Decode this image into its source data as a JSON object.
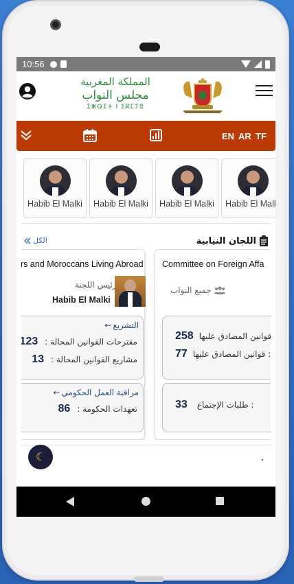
{
  "status_bar": {
    "time": "10:56"
  },
  "header": {
    "logo_line1": "المملكة المغربية",
    "logo_line2": "مجلس النواب",
    "logo_line3": "ⵉⵥⵕⵉⵜ ⵏ ⵉⴽⵎⵢⵓ",
    "icons": [
      "user-icon",
      "emblem",
      "menu-icon"
    ]
  },
  "toolbar": {
    "icons": [
      "chevron-double-down-icon",
      "calendar-icon",
      "bar-chart-icon"
    ],
    "languages": [
      "EN",
      "AR",
      "TF"
    ]
  },
  "members": [
    {
      "name": "Habib El Malki"
    },
    {
      "name": "Habib El Malki"
    },
    {
      "name": "Habib El Malki"
    },
    {
      "name": "Habib El Malki"
    }
  ],
  "committees_section": {
    "title": "اللجان النيابية",
    "see_all": "الكل"
  },
  "committees": [
    {
      "title": "rs and Moroccans Living Abroad",
      "president_label": "رئيس اللجنة",
      "president_name": "Habib El Malki",
      "legislation_header": "التشريع",
      "stats_legislation": [
        {
          "label": "مقترحات القوانين المحالة :",
          "value": "123"
        },
        {
          "label": "مشاريع القوانين المحالة :",
          "value": "13"
        }
      ],
      "oversight_header": "مراقبة العمل الحكومي",
      "stats_oversight": [
        {
          "label": "تعهدات الحكومة :",
          "value": "86"
        }
      ]
    },
    {
      "title": "Committee on Foreign Affa",
      "members_label": "جميع النواب",
      "stats_legislation": [
        {
          "label": "قوانين المصادق عليها:",
          "value": "258"
        },
        {
          "label": "قوانين المصادق عليها :",
          "value": "77"
        }
      ],
      "stats_meetings": [
        {
          "label": "طلبات الإجتماع :",
          "value": "33"
        }
      ]
    }
  ],
  "colors": {
    "toolbar_bg": "#bb3a05",
    "logo_green": "#2e8b3d",
    "stat_value": "#1b2a55",
    "link_blue": "#3b6fcf",
    "dark_toggle": "#1d1f3a"
  }
}
